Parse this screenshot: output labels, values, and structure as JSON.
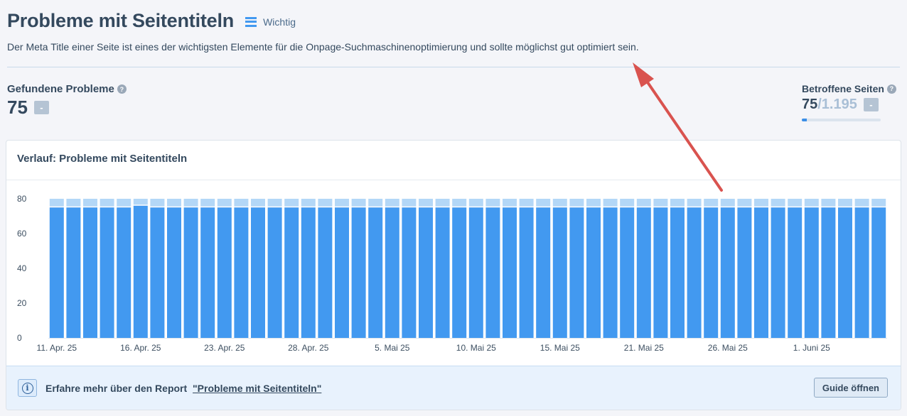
{
  "header": {
    "title": "Probleme mit Seitentiteln",
    "priority_label": "Wichtig",
    "priority_icon": "priority-bars-icon",
    "description": "Der Meta Title einer Seite ist eines der wichtigsten Elemente für die Onpage-Suchmaschinenoptimierung und sollte möglichst gut optimiert sein."
  },
  "metrics": {
    "found_label": "Gefundene Probleme",
    "found_value": "75",
    "found_delta": "-",
    "affected_label": "Betroffene Seiten",
    "affected_value": "75",
    "affected_total": "/1.195",
    "affected_delta": "-",
    "affected_fraction": 0.0628,
    "help_icon": "?"
  },
  "chart_card": {
    "title": "Verlauf: Probleme mit Seitentiteln"
  },
  "chart_data": {
    "type": "bar",
    "stacked": true,
    "ylim": [
      0,
      80
    ],
    "yticks": [
      0,
      20,
      40,
      60,
      80
    ],
    "x_tick_labels": [
      "11. Apr. 25",
      "16. Apr. 25",
      "23. Apr. 25",
      "28. Apr. 25",
      "5. Mai 25",
      "10. Mai 25",
      "15. Mai 25",
      "21. Mai 25",
      "26. Mai 25",
      "1. Juni 25"
    ],
    "x_tick_indices": [
      0,
      5,
      10,
      15,
      20,
      25,
      30,
      35,
      40,
      45
    ],
    "series": [
      {
        "values": [
          75,
          75,
          75,
          75,
          75,
          76,
          75,
          75,
          75,
          75,
          75,
          75,
          75,
          75,
          75,
          75,
          75,
          75,
          75,
          75,
          75,
          75,
          75,
          75,
          75,
          75,
          75,
          75,
          75,
          75,
          75,
          75,
          75,
          75,
          75,
          75,
          75,
          75,
          75,
          75,
          75,
          75,
          75,
          75,
          75,
          75,
          75,
          75,
          75,
          75
        ]
      },
      {
        "values": [
          5,
          5,
          5,
          5,
          5,
          4,
          5,
          5,
          5,
          5,
          5,
          5,
          5,
          5,
          5,
          5,
          5,
          5,
          5,
          5,
          5,
          5,
          5,
          5,
          5,
          5,
          5,
          5,
          5,
          5,
          5,
          5,
          5,
          5,
          5,
          5,
          5,
          5,
          5,
          5,
          5,
          5,
          5,
          5,
          5,
          5,
          5,
          5,
          5,
          5
        ]
      }
    ],
    "colors": [
      "#4299f0",
      "#b3d7f7"
    ],
    "grid": false
  },
  "footer": {
    "text": "Erfahre mehr über den Report",
    "link": "\"Probleme mit Seitentiteln\"",
    "button": "Guide öffnen",
    "info_icon": "i"
  }
}
